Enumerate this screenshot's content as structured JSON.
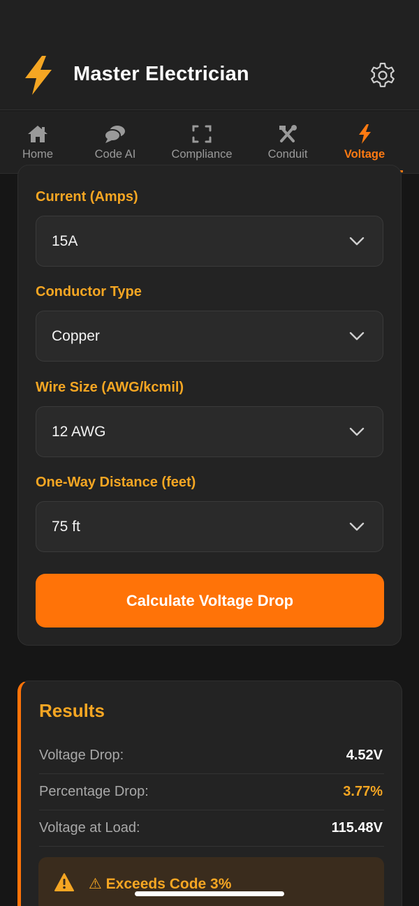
{
  "app": {
    "title": "Master Electrician",
    "logo_icon": "lightning-bolt-icon",
    "settings_icon": "gear-icon",
    "accent_color": "#ff7308",
    "label_color": "#f5a623"
  },
  "tabs": [
    {
      "label": "Home",
      "icon": "home-icon"
    },
    {
      "label": "Code AI",
      "icon": "chat-icon"
    },
    {
      "label": "Compliance",
      "icon": "scan-icon"
    },
    {
      "label": "Conduit",
      "icon": "tools-icon"
    },
    {
      "label": "Voltage",
      "icon": "lightning-bolt-icon",
      "active": true
    }
  ],
  "form": {
    "current": {
      "label": "Current (Amps)",
      "value": "15A"
    },
    "conductor": {
      "label": "Conductor Type",
      "value": "Copper"
    },
    "wire_size": {
      "label": "Wire Size (AWG/kcmil)",
      "value": "12 AWG"
    },
    "distance": {
      "label": "One-Way Distance (feet)",
      "value": "75 ft"
    },
    "calculate_label": "Calculate Voltage Drop"
  },
  "results": {
    "title": "Results",
    "rows": [
      {
        "label": "Voltage Drop:",
        "value": "4.52V"
      },
      {
        "label": "Percentage Drop:",
        "value": "3.77%"
      },
      {
        "label": "Voltage at Load:",
        "value": "115.48V"
      }
    ],
    "warning_text": "⚠ Exceeds Code 3%",
    "warning_icon": "warning-triangle-icon"
  }
}
